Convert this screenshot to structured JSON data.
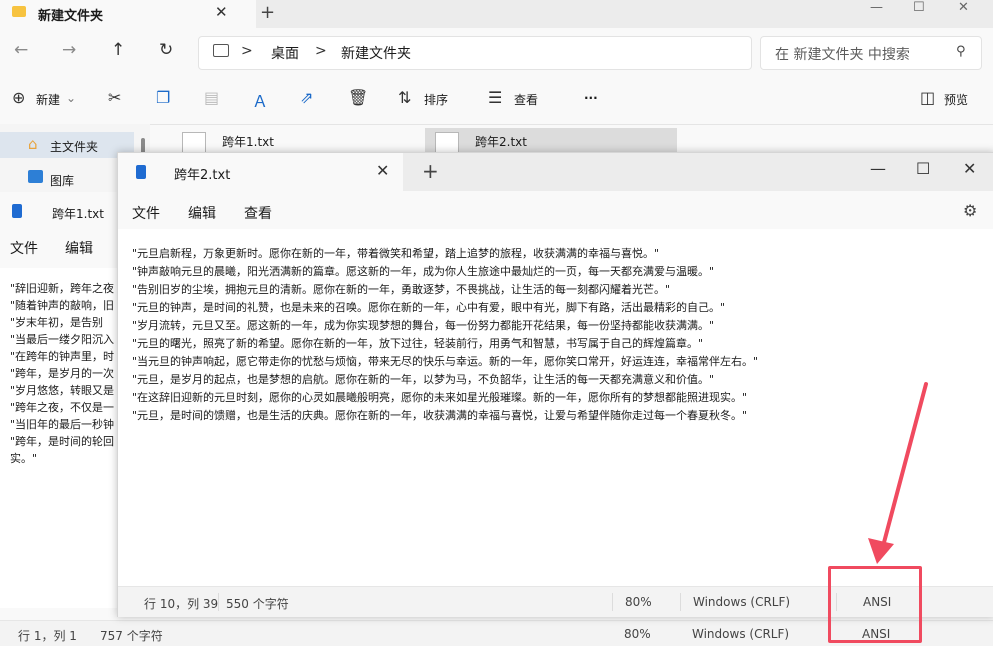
{
  "explorer": {
    "tab_title": "新建文件夹",
    "new_tab": "+",
    "nav": {
      "back": "←",
      "forward": "→",
      "up": "↑",
      "refresh": "↻"
    },
    "breadcrumb": [
      "桌面",
      "新建文件夹"
    ],
    "breadcrumb_sep": ">",
    "search_placeholder": "在 新建文件夹 中搜索",
    "toolbar": {
      "new_label": "新建",
      "sort_label": "排序",
      "view_label": "查看",
      "more": "···",
      "preview_label": "预览"
    },
    "sidebar": [
      {
        "label": "主文件夹"
      },
      {
        "label": "图库"
      }
    ],
    "files": [
      {
        "name": "跨年1.txt"
      },
      {
        "name": "跨年2.txt"
      }
    ],
    "status": {
      "position": "行 1，列 1",
      "chars": "757 个字符",
      "zoom": "80%",
      "line_ending": "Windows (CRLF)",
      "encoding": "ANSI"
    }
  },
  "notepad_back": {
    "tab_title": "跨年1.txt",
    "menu": [
      "文件",
      "编辑"
    ],
    "lines": [
      "\"辞旧迎新，跨年之夜",
      "\"随着钟声的敲响，旧",
      "\"岁末年初，是告别",
      "\"当最后一缕夕阳沉入",
      "\"在跨年的钟声里，时",
      "\"跨年，是岁月的一次",
      "\"岁月悠悠，转眼又是",
      "\"跨年之夜，不仅是一",
      "\"当旧年的最后一秒钟",
      "\"跨年，是时间的轮回",
      "实。\""
    ]
  },
  "notepad": {
    "tab_title": "跨年2.txt",
    "new_tab": "+",
    "controls": {
      "minimize": "—",
      "maximize": "☐",
      "close": "✕"
    },
    "menu": [
      "文件",
      "编辑",
      "查看"
    ],
    "lines": [
      "\"元旦启新程，万象更新时。愿你在新的一年，带着微笑和希望，踏上追梦的旅程，收获满满的幸福与喜悦。\"",
      "\"钟声敲响元旦的晨曦，阳光洒满新的篇章。愿这新的一年，成为你人生旅途中最灿烂的一页，每一天都充满爱与温暖。\"",
      "\"告别旧岁的尘埃，拥抱元旦的清新。愿你在新的一年，勇敢逐梦，不畏挑战，让生活的每一刻都闪耀着光芒。\"",
      "\"元旦的钟声，是时间的礼赞，也是未来的召唤。愿你在新的一年，心中有爱，眼中有光，脚下有路，活出最精彩的自己。\"",
      "\"岁月流转，元旦又至。愿这新的一年，成为你实现梦想的舞台，每一份努力都能开花结果，每一份坚持都能收获满满。\"",
      "\"元旦的曙光，照亮了新的希望。愿你在新的一年，放下过往，轻装前行，用勇气和智慧，书写属于自己的辉煌篇章。\"",
      "\"当元旦的钟声响起，愿它带走你的忧愁与烦恼，带来无尽的快乐与幸运。新的一年，愿你笑口常开，好运连连，幸福常伴左右。\"",
      "\"元旦，是岁月的起点，也是梦想的启航。愿你在新的一年，以梦为马，不负韶华，让生活的每一天都充满意义和价值。\"",
      "\"在这辞旧迎新的元旦时刻，愿你的心灵如晨曦般明亮，愿你的未来如星光般璀璨。新的一年，愿你所有的梦想都能照进现实。\"",
      "\"元旦，是时间的馈赠，也是生活的庆典。愿你在新的一年，收获满满的幸福与喜悦，让爱与希望伴随你走过每一个春夏秋冬。\""
    ],
    "status": {
      "position": "行 10，列 39",
      "chars": "550 个字符",
      "zoom": "80%",
      "line_ending": "Windows (CRLF)",
      "encoding": "ANSI"
    }
  },
  "colors": {
    "highlight": "#f04a5f",
    "accent": "#1b6ac9"
  }
}
